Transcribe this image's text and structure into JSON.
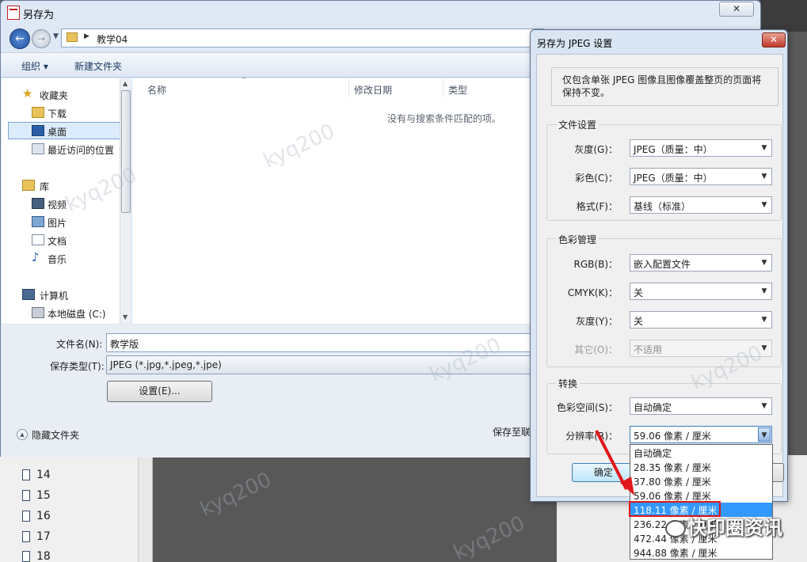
{
  "background": {
    "pages": [
      "14",
      "15",
      "16",
      "17",
      "18"
    ]
  },
  "save_dialog": {
    "title": "另存为",
    "close_label": "✕",
    "address": {
      "folder": "教学04"
    },
    "toolbar": {
      "organize": "组织 ▾",
      "new_folder": "新建文件夹"
    },
    "nav": [
      {
        "label": "收藏夹",
        "icon": "star-icon"
      },
      {
        "label": "下载",
        "icon": "download-folder-icon"
      },
      {
        "label": "桌面",
        "icon": "desktop-icon"
      },
      {
        "label": "最近访问的位置",
        "icon": "recent-places-icon"
      },
      {
        "label": "库",
        "icon": "library-icon"
      },
      {
        "label": "视频",
        "icon": "video-icon"
      },
      {
        "label": "图片",
        "icon": "picture-icon"
      },
      {
        "label": "文档",
        "icon": "document-icon"
      },
      {
        "label": "音乐",
        "icon": "music-icon"
      },
      {
        "label": "计算机",
        "icon": "computer-icon"
      },
      {
        "label": "本地磁盘 (C:)",
        "icon": "disk-icon"
      }
    ],
    "columns": {
      "name": "名称",
      "date": "修改日期",
      "type": "类型"
    },
    "empty_message": "没有与搜索条件匹配的项。",
    "filename_label": "文件名(N):",
    "filename_value": "教学版",
    "filetype_label": "保存类型(T):",
    "filetype_value": "JPEG (*.jpg,*.jpeg,*.jpe)",
    "settings_button": "设置(E)...",
    "hide_folders": "隐藏文件夹",
    "save_to": "保存至联"
  },
  "jpeg_dialog": {
    "title": "另存为 JPEG 设置",
    "close_label": "✕",
    "info": "仅包含单张 JPEG 图像且图像覆盖整页的页面将保持不变。",
    "file_settings": {
      "title": "文件设置",
      "rows": [
        {
          "label": "灰度(G)：",
          "value": "JPEG（质量：中）"
        },
        {
          "label": "彩色(C)：",
          "value": "JPEG（质量：中）"
        },
        {
          "label": "格式(F)：",
          "value": "基线（标准）"
        }
      ]
    },
    "color_management": {
      "title": "色彩管理",
      "rows": [
        {
          "label": "RGB(B)：",
          "value": "嵌入配置文件"
        },
        {
          "label": "CMYK(K)：",
          "value": "关"
        },
        {
          "label": "灰度(Y)：",
          "value": "关"
        },
        {
          "label": "其它(O)：",
          "value": "不适用"
        }
      ]
    },
    "conversion": {
      "title": "转换",
      "colorspace_label": "色彩空间(S)：",
      "colorspace_value": "自动确定",
      "resolution_label": "分辨率(R)：",
      "resolution_value": "59.06 像素 / 厘米"
    },
    "ok_button": "确定",
    "resolution_options": [
      "自动确定",
      "28.35 像素 / 厘米",
      "37.80 像素 / 厘米",
      "59.06 像素 / 厘米",
      "118.11 像素 / 厘米",
      "236.22 像素 / 厘米",
      "472.44 像素 / 厘米",
      "944.88 像素 / 厘米"
    ],
    "highlighted_option": "118.11 像素 / 厘米"
  },
  "watermark": {
    "brand": "快印圈资讯"
  },
  "colors": {
    "highlight": "#3399ff",
    "annotation_red": "#e0171b"
  }
}
